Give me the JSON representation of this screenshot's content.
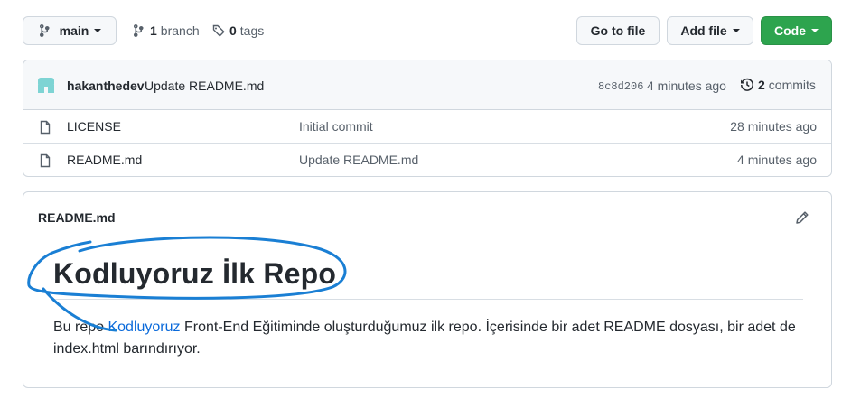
{
  "toolbar": {
    "branch_name": "main",
    "branch_count": "1",
    "branch_label": "branch",
    "tag_count": "0",
    "tag_label": "tags",
    "goto_file_label": "Go to file",
    "add_file_label": "Add file",
    "code_label": "Code"
  },
  "commit": {
    "author": "hakanthedev",
    "message": "Update README.md",
    "sha": "8c8d206",
    "time": "4 minutes ago",
    "commit_count": "2",
    "commits_label": "commits"
  },
  "files": [
    {
      "name": "LICENSE",
      "message": "Initial commit",
      "time": "28 minutes ago"
    },
    {
      "name": "README.md",
      "message": "Update README.md",
      "time": "4 minutes ago"
    }
  ],
  "readme": {
    "title": "README.md",
    "heading": "Kodluyoruz İlk Repo",
    "para_before": "Bu repo ",
    "para_link": "Kodluyoruz",
    "para_after": " Front-End Eğitiminde oluşturduğumuz ilk repo. İçerisinde bir adet README dosyası, bir adet de index.html barındırıyor."
  },
  "colors": {
    "primary_button": "#2da44e",
    "link": "#0969da",
    "annotation": "#1a7fd4",
    "avatar": "#7ed4d4"
  },
  "icons": [
    "git-branch-icon",
    "tag-icon",
    "history-icon",
    "file-icon",
    "pencil-icon"
  ]
}
